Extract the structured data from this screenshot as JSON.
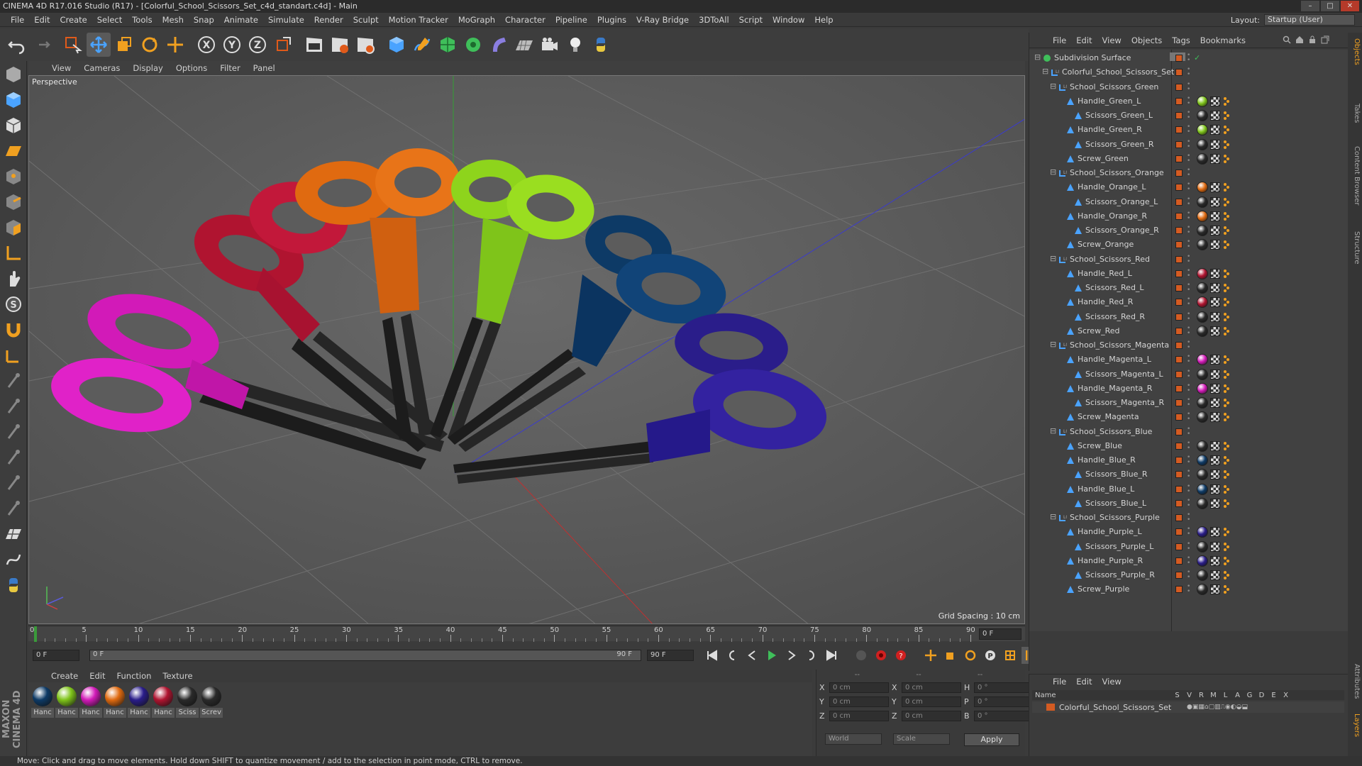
{
  "window": {
    "title": "CINEMA 4D R17.016 Studio (R17) - [Colorful_School_Scissors_Set_c4d_standart.c4d] - Main",
    "controls": [
      "–",
      "□",
      "✕"
    ]
  },
  "menubar": {
    "items": [
      "File",
      "Edit",
      "Create",
      "Select",
      "Tools",
      "Mesh",
      "Snap",
      "Animate",
      "Simulate",
      "Render",
      "Sculpt",
      "Motion Tracker",
      "MoGraph",
      "Character",
      "Pipeline",
      "Plugins",
      "V-Ray Bridge",
      "3DToAll",
      "Script",
      "Window",
      "Help"
    ],
    "layout_label": "Layout:",
    "layout_value": "Startup (User)"
  },
  "viewport": {
    "menu": [
      "View",
      "Cameras",
      "Display",
      "Options",
      "Filter",
      "Panel"
    ],
    "label": "Perspective",
    "grid_spacing": "Grid Spacing : 10 cm"
  },
  "timeline": {
    "ticks": [
      "0",
      "5",
      "10",
      "15",
      "20",
      "25",
      "30",
      "35",
      "40",
      "45",
      "50",
      "55",
      "60",
      "65",
      "70",
      "75",
      "80",
      "85",
      "90"
    ],
    "current_frame": "0 F",
    "start_field": "0 F",
    "range_start": "0 F",
    "range_end": "90 F",
    "end_field": "90 F"
  },
  "materials": {
    "menu": [
      "Create",
      "Edit",
      "Function",
      "Texture"
    ],
    "items": [
      {
        "name": "Hanc",
        "color": "#0d3a66"
      },
      {
        "name": "Hanc",
        "color": "#7fc41a"
      },
      {
        "name": "Hanc",
        "color": "#d21ab8"
      },
      {
        "name": "Hanc",
        "color": "#e06a10"
      },
      {
        "name": "Hanc",
        "color": "#2a1d8a"
      },
      {
        "name": "Hanc",
        "color": "#b01430"
      },
      {
        "name": "Sciss",
        "color": "#2a2a2a"
      },
      {
        "name": "Screv",
        "color": "#2a2a2a"
      }
    ]
  },
  "coords": {
    "header": [
      "--",
      "--",
      "--"
    ],
    "rows": [
      {
        "a": "X",
        "av": "0 cm",
        "b": "X",
        "bv": "0 cm",
        "c": "H",
        "cv": "0 °"
      },
      {
        "a": "Y",
        "av": "0 cm",
        "b": "Y",
        "bv": "0 cm",
        "c": "P",
        "cv": "0 °"
      },
      {
        "a": "Z",
        "av": "0 cm",
        "b": "Z",
        "bv": "0 cm",
        "c": "B",
        "cv": "0 °"
      }
    ],
    "mode": "World",
    "scale": "Scale",
    "apply": "Apply"
  },
  "status": "Move: Click and drag to move elements. Hold down SHIFT to quantize movement / add to the selection in point mode, CTRL to remove.",
  "maxon": "MAXON CINEMA 4D",
  "objects_panel": {
    "menu": [
      "File",
      "Edit",
      "View",
      "Objects",
      "Tags",
      "Bookmarks"
    ],
    "rows": [
      {
        "name": "Subdivision Surface",
        "level": 0,
        "kind": "sub"
      },
      {
        "name": "Colorful_School_Scissors_Set",
        "level": 1,
        "kind": "null"
      },
      {
        "name": "School_Scissors_Green",
        "level": 2,
        "kind": "null"
      },
      {
        "name": "Handle_Green_L",
        "level": 3,
        "kind": "poly",
        "tag": "#7fc41a"
      },
      {
        "name": "Scissors_Green_L",
        "level": 4,
        "kind": "poly",
        "tag": "#2a2a2a"
      },
      {
        "name": "Handle_Green_R",
        "level": 3,
        "kind": "poly",
        "tag": "#7fc41a"
      },
      {
        "name": "Scissors_Green_R",
        "level": 4,
        "kind": "poly",
        "tag": "#2a2a2a"
      },
      {
        "name": "Screw_Green",
        "level": 3,
        "kind": "poly",
        "tag": "#2a2a2a"
      },
      {
        "name": "School_Scissors_Orange",
        "level": 2,
        "kind": "null"
      },
      {
        "name": "Handle_Orange_L",
        "level": 3,
        "kind": "poly",
        "tag": "#e06a10"
      },
      {
        "name": "Scissors_Orange_L",
        "level": 4,
        "kind": "poly",
        "tag": "#2a2a2a"
      },
      {
        "name": "Handle_Orange_R",
        "level": 3,
        "kind": "poly",
        "tag": "#e06a10"
      },
      {
        "name": "Scissors_Orange_R",
        "level": 4,
        "kind": "poly",
        "tag": "#2a2a2a"
      },
      {
        "name": "Screw_Orange",
        "level": 3,
        "kind": "poly",
        "tag": "#2a2a2a"
      },
      {
        "name": "School_Scissors_Red",
        "level": 2,
        "kind": "null"
      },
      {
        "name": "Handle_Red_L",
        "level": 3,
        "kind": "poly",
        "tag": "#b01430"
      },
      {
        "name": "Scissors_Red_L",
        "level": 4,
        "kind": "poly",
        "tag": "#2a2a2a"
      },
      {
        "name": "Handle_Red_R",
        "level": 3,
        "kind": "poly",
        "tag": "#b01430"
      },
      {
        "name": "Scissors_Red_R",
        "level": 4,
        "kind": "poly",
        "tag": "#2a2a2a"
      },
      {
        "name": "Screw_Red",
        "level": 3,
        "kind": "poly",
        "tag": "#2a2a2a"
      },
      {
        "name": "School_Scissors_Magenta",
        "level": 2,
        "kind": "null"
      },
      {
        "name": "Handle_Magenta_L",
        "level": 3,
        "kind": "poly",
        "tag": "#d21ab8"
      },
      {
        "name": "Scissors_Magenta_L",
        "level": 4,
        "kind": "poly",
        "tag": "#2a2a2a"
      },
      {
        "name": "Handle_Magenta_R",
        "level": 3,
        "kind": "poly",
        "tag": "#d21ab8"
      },
      {
        "name": "Scissors_Magenta_R",
        "level": 4,
        "kind": "poly",
        "tag": "#2a2a2a"
      },
      {
        "name": "Screw_Magenta",
        "level": 3,
        "kind": "poly",
        "tag": "#2a2a2a"
      },
      {
        "name": "School_Scissors_Blue",
        "level": 2,
        "kind": "null"
      },
      {
        "name": "Screw_Blue",
        "level": 3,
        "kind": "poly",
        "tag": "#2a2a2a"
      },
      {
        "name": "Handle_Blue_R",
        "level": 3,
        "kind": "poly",
        "tag": "#0d3a66"
      },
      {
        "name": "Scissors_Blue_R",
        "level": 4,
        "kind": "poly",
        "tag": "#2a2a2a"
      },
      {
        "name": "Handle_Blue_L",
        "level": 3,
        "kind": "poly",
        "tag": "#0d3a66"
      },
      {
        "name": "Scissors_Blue_L",
        "level": 4,
        "kind": "poly",
        "tag": "#2a2a2a"
      },
      {
        "name": "School_Scissors_Purple",
        "level": 2,
        "kind": "null"
      },
      {
        "name": "Handle_Purple_L",
        "level": 3,
        "kind": "poly",
        "tag": "#2a1d8a"
      },
      {
        "name": "Scissors_Purple_L",
        "level": 4,
        "kind": "poly",
        "tag": "#2a2a2a"
      },
      {
        "name": "Handle_Purple_R",
        "level": 3,
        "kind": "poly",
        "tag": "#2a1d8a"
      },
      {
        "name": "Scissors_Purple_R",
        "level": 4,
        "kind": "poly",
        "tag": "#2a2a2a"
      },
      {
        "name": "Screw_Purple",
        "level": 3,
        "kind": "poly",
        "tag": "#2a2a2a"
      }
    ]
  },
  "side_tabs": [
    "Objects",
    "Takes",
    "Content Browser",
    "Structure",
    "Attributes",
    "Layers"
  ],
  "layers_panel": {
    "menu": [
      "File",
      "Edit",
      "View"
    ],
    "columns": [
      "Name",
      "S",
      "V",
      "R",
      "M",
      "L",
      "A",
      "G",
      "D",
      "E",
      "X"
    ],
    "row_name": "Colorful_School_Scissors_Set"
  }
}
